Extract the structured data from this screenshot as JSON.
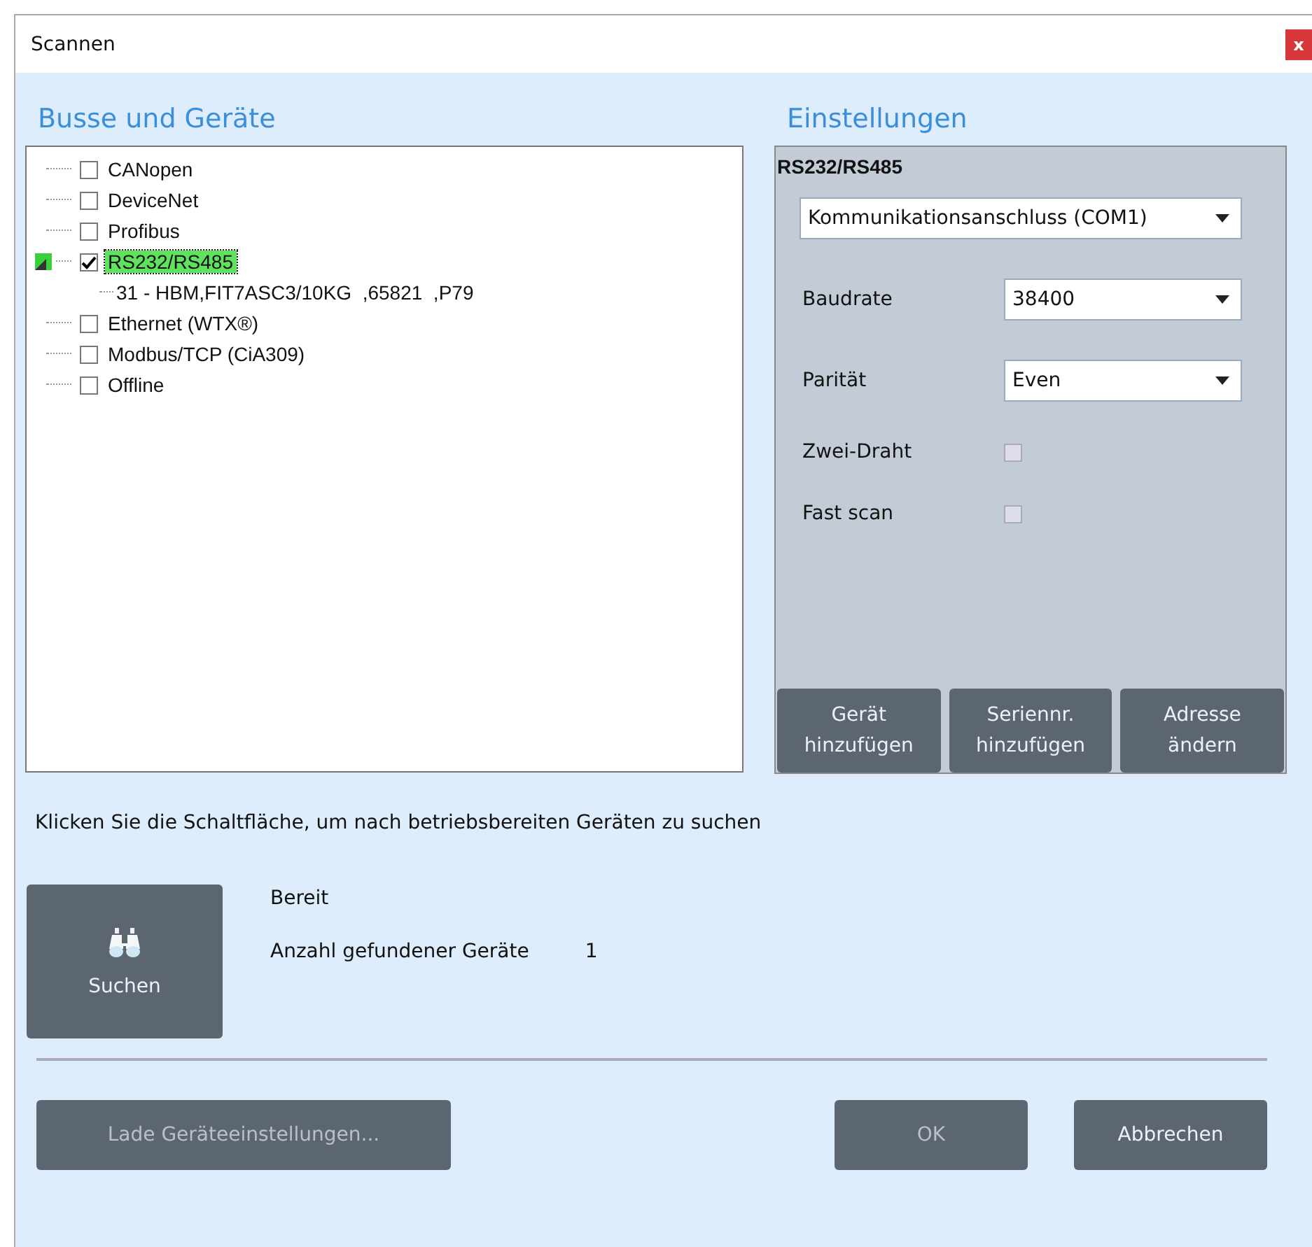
{
  "window": {
    "title": "Scannen",
    "close": "x"
  },
  "buses": {
    "heading": "Busse und Geräte",
    "tree": [
      {
        "label": "CANopen",
        "checked": false,
        "selected": false
      },
      {
        "label": "DeviceNet",
        "checked": false,
        "selected": false
      },
      {
        "label": "Profibus",
        "checked": false,
        "selected": false
      },
      {
        "label": "RS232/RS485",
        "checked": true,
        "selected": true,
        "expanded": true,
        "children": [
          {
            "label": "31 - HBM,FIT7ASC3/10KG  ,65821  ,P79"
          }
        ]
      },
      {
        "label": "Ethernet (WTX®)",
        "checked": false,
        "selected": false
      },
      {
        "label": "Modbus/TCP (CiA309)",
        "checked": false,
        "selected": false
      },
      {
        "label": "Offline",
        "checked": false,
        "selected": false
      }
    ]
  },
  "settings": {
    "heading": "Einstellungen",
    "panel_title": "RS232/RS485",
    "port": "Kommunikationsanschluss (COM1)",
    "fields": [
      {
        "kind": "select",
        "label": "Baudrate",
        "value": "38400"
      },
      {
        "kind": "select",
        "label": "Parität",
        "value": "Even"
      },
      {
        "kind": "checkbox",
        "label": "Zwei-Draht",
        "checked": false
      },
      {
        "kind": "checkbox",
        "label": "Fast scan",
        "checked": false
      }
    ],
    "buttons": [
      {
        "lines": [
          "Gerät",
          "hinzufügen"
        ]
      },
      {
        "lines": [
          "Seriennr.",
          "hinzufügen"
        ]
      },
      {
        "lines": [
          "Adresse",
          "ändern"
        ]
      }
    ]
  },
  "hint": "Klicken Sie die Schaltfläche, um nach betriebsbereiten Geräten zu suchen",
  "search_button": {
    "label": "Suchen"
  },
  "status": "Bereit",
  "found": {
    "label": "Anzahl gefundener Geräte",
    "value": "1"
  },
  "footer": [
    {
      "label": "Lade Geräteeinstellungen...",
      "disabled": true,
      "kind": "left"
    },
    {
      "label": "OK",
      "disabled": true,
      "kind": "right"
    },
    {
      "label": "Abbrechen",
      "disabled": false,
      "kind": "right"
    }
  ]
}
